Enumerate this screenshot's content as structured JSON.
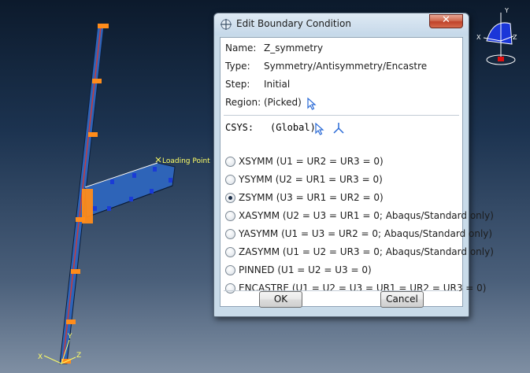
{
  "dialog": {
    "title": "Edit Boundary Condition",
    "close_symbol": "✕",
    "name_label": "Name:",
    "name_value": "Z_symmetry",
    "type_label": "Type:",
    "type_value": "Symmetry/Antisymmetry/Encastre",
    "step_label": "Step:",
    "step_value": "Initial",
    "region_label": "Region:",
    "region_value": "(Picked)",
    "csys_label": "CSYS:",
    "csys_value": "(Global)",
    "options": [
      {
        "label": "XSYMM (U1 = UR2 = UR3 = 0)",
        "checked": false
      },
      {
        "label": "YSYMM (U2 = UR1 = UR3 = 0)",
        "checked": false
      },
      {
        "label": "ZSYMM (U3 = UR1 = UR2 = 0)",
        "checked": true
      },
      {
        "label": "XASYMM (U2 = U3 = UR1 = 0; Abaqus/Standard only)",
        "checked": false
      },
      {
        "label": "YASYMM (U1 = U3 = UR2 = 0; Abaqus/Standard only)",
        "checked": false
      },
      {
        "label": "ZASYMM (U1 = U2 = UR3 = 0; Abaqus/Standard only)",
        "checked": false
      },
      {
        "label": "PINNED (U1 = U2 = U3 = 0)",
        "checked": false
      },
      {
        "label": "ENCASTRE (U1 = U2 = U3 = UR1 = UR2 = UR3 = 0)",
        "checked": false
      }
    ],
    "ok_label": "OK",
    "cancel_label": "Cancel"
  },
  "viewport": {
    "annotation": "Loading Point",
    "triad_small": {
      "x": "X",
      "y": "Y",
      "z": "Z"
    },
    "triad_view": {
      "x": "X",
      "y": "Y",
      "z": "Z"
    }
  },
  "colors": {
    "dialog_bg": "#c9dbe9",
    "part_blue": "#2e64b8",
    "constraint_orange": "#ff8c1a",
    "annotation_yellow": "#ffff66"
  }
}
